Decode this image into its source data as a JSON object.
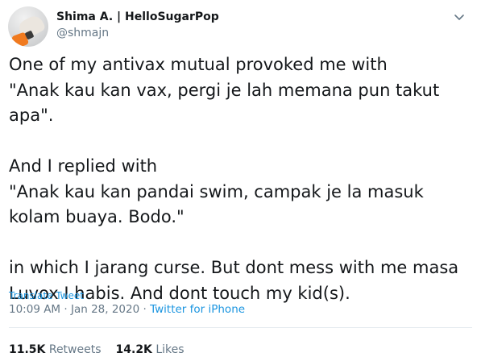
{
  "author": {
    "display_name": "Shima A. | HelloSugarPop",
    "handle": "@shmajn",
    "avatar_icon": "avatar-photo"
  },
  "menu": {
    "icon": "chevron-down-icon"
  },
  "tweet": {
    "text": "One of my antivax mutual provoked me with\n\"Anak kau kan vax, pergi je lah memana pun takut apa\".\n\nAnd I replied with\n\"Anak kau kan pandai swim, campak je la masuk kolam buaya. Bodo.\"\n\nin which I jarang curse. But dont mess with me masa Luvox I habis. And dont touch my kid(s).",
    "translate_label": "Translate Tweet",
    "time": "10:09 AM",
    "date": "Jan 28, 2020",
    "separator": "·",
    "source": "Twitter for iPhone"
  },
  "stats": {
    "retweets_count": "11.5K",
    "retweets_label": "Retweets",
    "likes_count": "14.2K",
    "likes_label": "Likes"
  },
  "colors": {
    "link": "#1b95e0",
    "muted": "#657786",
    "text": "#14171a"
  }
}
